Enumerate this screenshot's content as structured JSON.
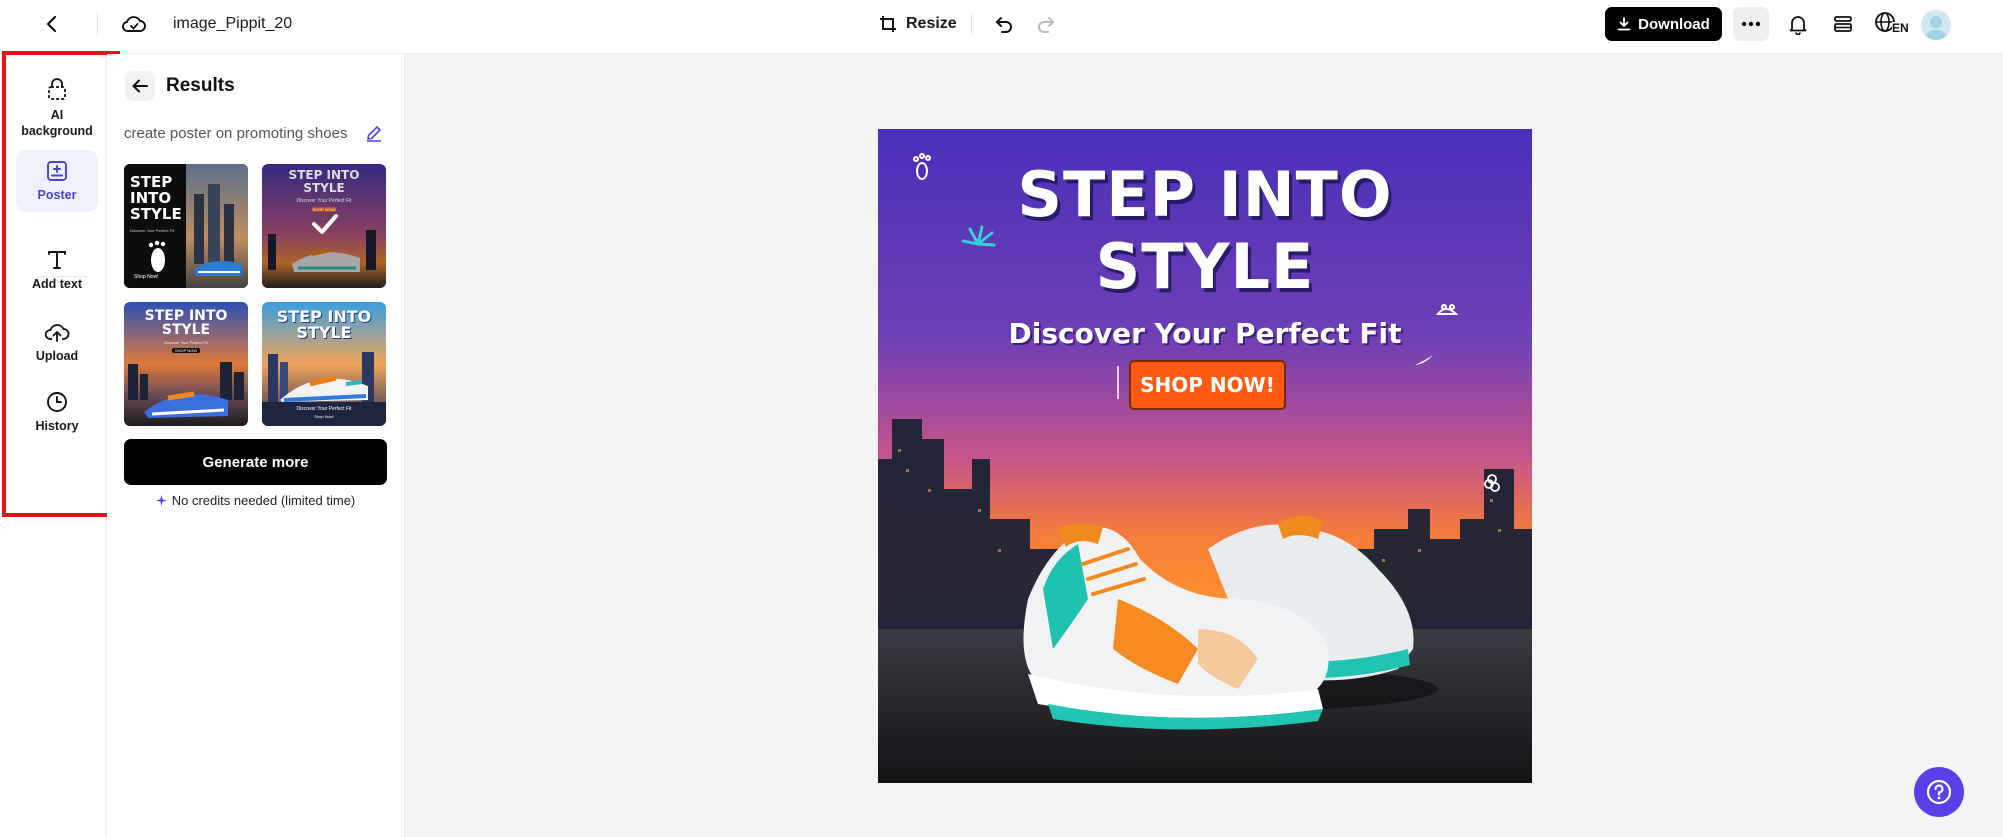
{
  "topbar": {
    "file_name": "image_Pippit_20",
    "resize_label": "Resize",
    "download_label": "Download",
    "language_badge": "EN"
  },
  "rail": {
    "items": [
      {
        "label": "AI background",
        "icon": "ai-background-icon"
      },
      {
        "label": "Poster",
        "icon": "poster-icon",
        "active": true
      },
      {
        "label": "Add text",
        "icon": "text-icon"
      },
      {
        "label": "Upload",
        "icon": "upload-icon"
      },
      {
        "label": "History",
        "icon": "history-icon"
      }
    ],
    "highlight_color": "#e8101a"
  },
  "panel": {
    "title": "Results",
    "prompt": "create poster on promoting shoes",
    "thumbnails": [
      {
        "lines": [
          "STEP",
          "INTO",
          "STYLE"
        ],
        "sub": "Discover Your Perfect Fit",
        "cta": "Shop Now!"
      },
      {
        "lines": [
          "STEP INTO",
          "STYLE"
        ],
        "sub": "Discover Your Perfect Fit",
        "cta": "SHOP NOW!",
        "selected": true
      },
      {
        "lines": [
          "STEP INTO",
          "STYLE"
        ],
        "sub": "Discover Your Perfect Fit",
        "cta": "SHOP NOW"
      },
      {
        "lines": [
          "STEP INTO",
          "STYLE"
        ],
        "sub": "Discover Your Perfect Fit",
        "cta": "Shop Now!"
      }
    ],
    "generate_label": "Generate more",
    "credits_note": "No credits needed (limited time)"
  },
  "poster": {
    "title_line1": "STEP INTO",
    "title_line2": "STYLE",
    "subtitle": "Discover Your Perfect Fit",
    "cta": "SHOP NOW!"
  },
  "colors": {
    "accent": "#5940e8",
    "cta_orange": "#ff5a12",
    "poster_top": "#4a2fb8"
  }
}
